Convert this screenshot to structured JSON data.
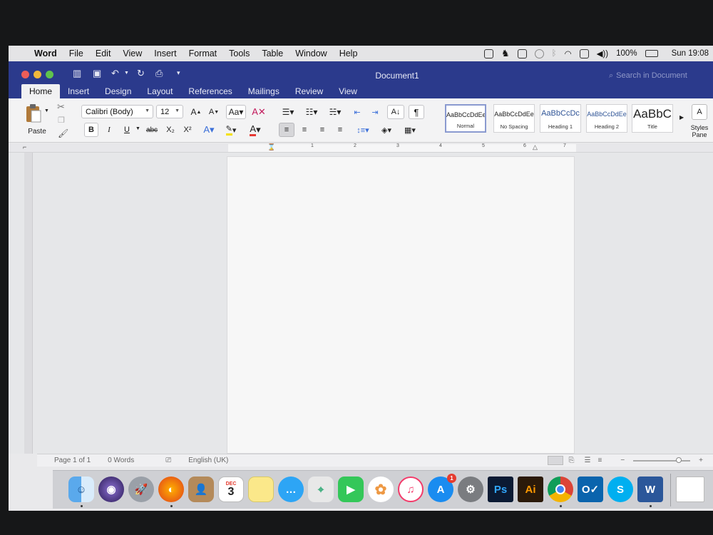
{
  "menubar": {
    "items": [
      "Word",
      "File",
      "Edit",
      "View",
      "Insert",
      "Format",
      "Tools",
      "Table",
      "Window",
      "Help"
    ],
    "battery": "100%",
    "clock": "Sun 19:08"
  },
  "window": {
    "title": "Document1",
    "search_placeholder": "Search in Document",
    "tabs": [
      "Home",
      "Insert",
      "Design",
      "Layout",
      "References",
      "Mailings",
      "Review",
      "View"
    ]
  },
  "ribbon": {
    "paste_label": "Paste",
    "font_name": "Calibri (Body)",
    "font_size": "12",
    "styles": [
      {
        "sample": "AaBbCcDdEe",
        "name": "Normal"
      },
      {
        "sample": "AaBbCcDdEe",
        "name": "No Spacing"
      },
      {
        "sample": "AaBbCcDc",
        "name": "Heading 1"
      },
      {
        "sample": "AaBbCcDdEe",
        "name": "Heading 2"
      },
      {
        "sample": "AaBbC",
        "name": "Title"
      }
    ],
    "styles_pane_label": "Styles Pane",
    "bold": "B",
    "italic": "I",
    "underline": "U",
    "strike": "abc",
    "subscript": "X₂",
    "superscript": "X²"
  },
  "ruler": {
    "labels": [
      "1",
      "2",
      "3",
      "4",
      "5",
      "6",
      "7"
    ]
  },
  "statusbar": {
    "page": "Page 1 of 1",
    "words": "0 Words",
    "language": "English (UK)"
  },
  "dock": {
    "ps_label": "Ps",
    "ai_label": "Ai",
    "calendar_month": "DEC",
    "calendar_day": "3",
    "appstore_badge": "1"
  },
  "colors": {
    "ribbon_blue": "#2b3a8c",
    "page": "#f7f7f7",
    "canvas": "#e6e7e9"
  }
}
